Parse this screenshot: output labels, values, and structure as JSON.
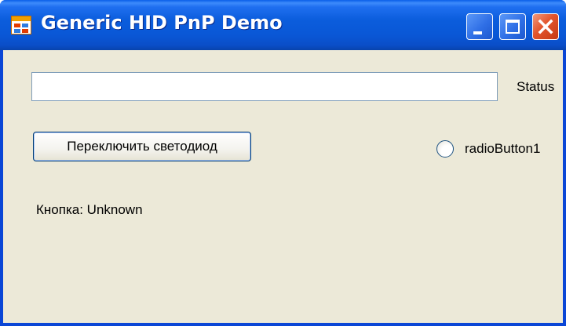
{
  "window": {
    "title": "Generic HID PnP Demo"
  },
  "icons": {
    "app": "app-form-icon",
    "minimize": "minimize-icon",
    "maximize": "maximize-icon",
    "close": "close-icon",
    "radio": "radio-circle-icon"
  },
  "form": {
    "status_input_value": "",
    "status_label": "Status",
    "toggle_led_button_label": "Переключить светодиод",
    "radio_label": "radioButton1",
    "radio_checked": false,
    "button_state_text": "Кнопка: Unknown"
  },
  "colors": {
    "titlebar": "#0b5ddc",
    "window_border": "#0a46d6",
    "client_background": "#ece9d8",
    "close_button": "#e2542b"
  }
}
